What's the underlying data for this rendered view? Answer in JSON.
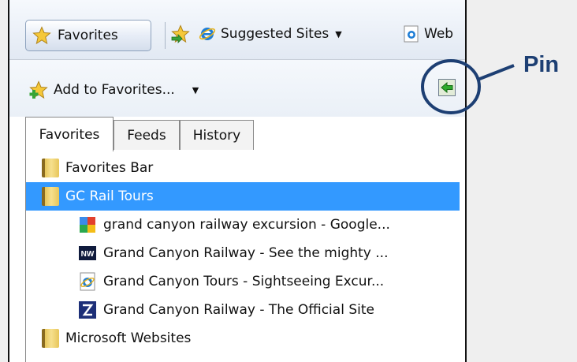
{
  "toolbar": {
    "favorites_label": "Favorites",
    "suggested_label": "Suggested Sites",
    "web_slice_label": "Web"
  },
  "add_row": {
    "add_label": "Add to Favorites..."
  },
  "tabs": [
    {
      "label": "Favorites",
      "active": true
    },
    {
      "label": "Feeds",
      "active": false
    },
    {
      "label": "History",
      "active": false
    }
  ],
  "tree": [
    {
      "label": "Favorites Bar",
      "type": "folder",
      "icon": "folder-icon"
    },
    {
      "label": "GC Rail Tours",
      "type": "folder",
      "icon": "folder-icon",
      "selected": true
    },
    {
      "label": "grand canyon railway excursion - Google...",
      "type": "link",
      "icon": "google-icon"
    },
    {
      "label": "Grand Canyon Railway - See the mighty ...",
      "type": "link",
      "icon": "nw-site-icon"
    },
    {
      "label": "Grand Canyon Tours - Sightseeing Excur...",
      "type": "link",
      "icon": "ie-page-icon"
    },
    {
      "label": "Grand Canyon Railway - The Official Site",
      "type": "link",
      "icon": "gcr-logo-icon"
    },
    {
      "label": "Microsoft Websites",
      "type": "folder",
      "icon": "folder-icon"
    }
  ],
  "callout": {
    "label": "Pin",
    "color": "#1d3f73"
  },
  "colors": {
    "selection": "#3399ff",
    "pin_button": "#2eaa2e"
  }
}
